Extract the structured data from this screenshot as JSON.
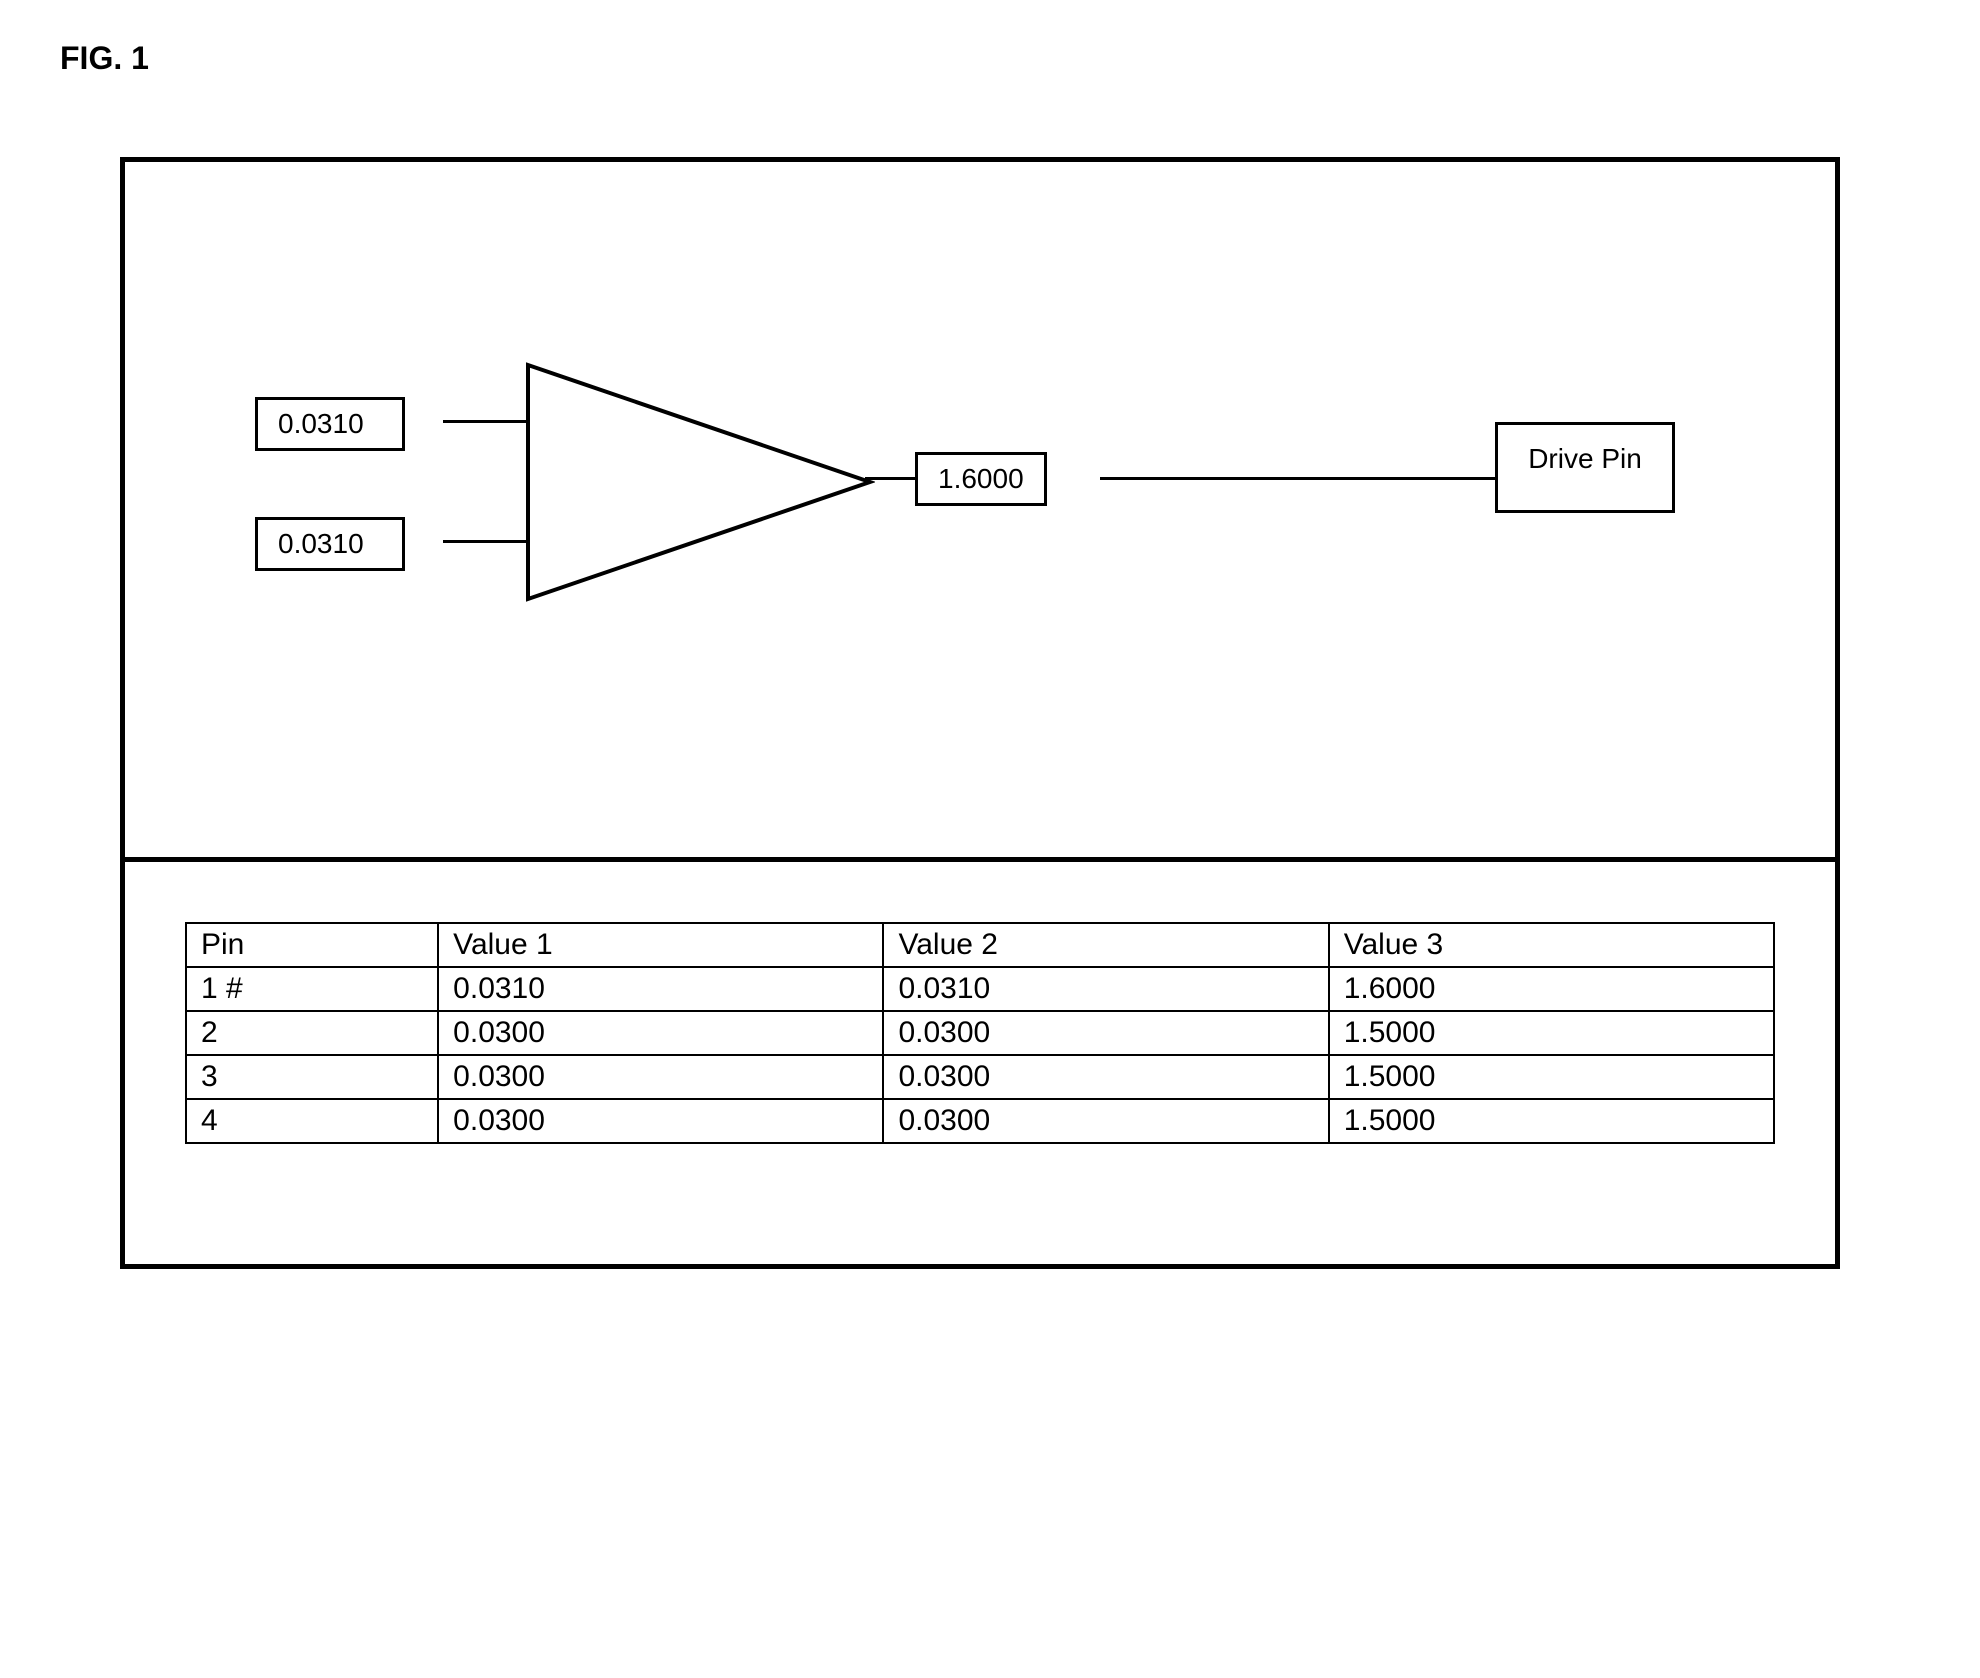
{
  "figure_title": "FIG. 1",
  "diagram": {
    "input1_value": "0.0310",
    "input2_value": "0.0310",
    "output_value": "1.6000",
    "drive_pin_label": "Drive Pin"
  },
  "table": {
    "headers": [
      "Pin",
      "Value 1",
      "Value 2",
      "Value 3"
    ],
    "rows": [
      [
        "1 #",
        "0.0310",
        "0.0310",
        "1.6000"
      ],
      [
        "2",
        "0.0300",
        "0.0300",
        "1.5000"
      ],
      [
        "3",
        "0.0300",
        "0.0300",
        "1.5000"
      ],
      [
        "4",
        "0.0300",
        "0.0300",
        "1.5000"
      ]
    ]
  }
}
